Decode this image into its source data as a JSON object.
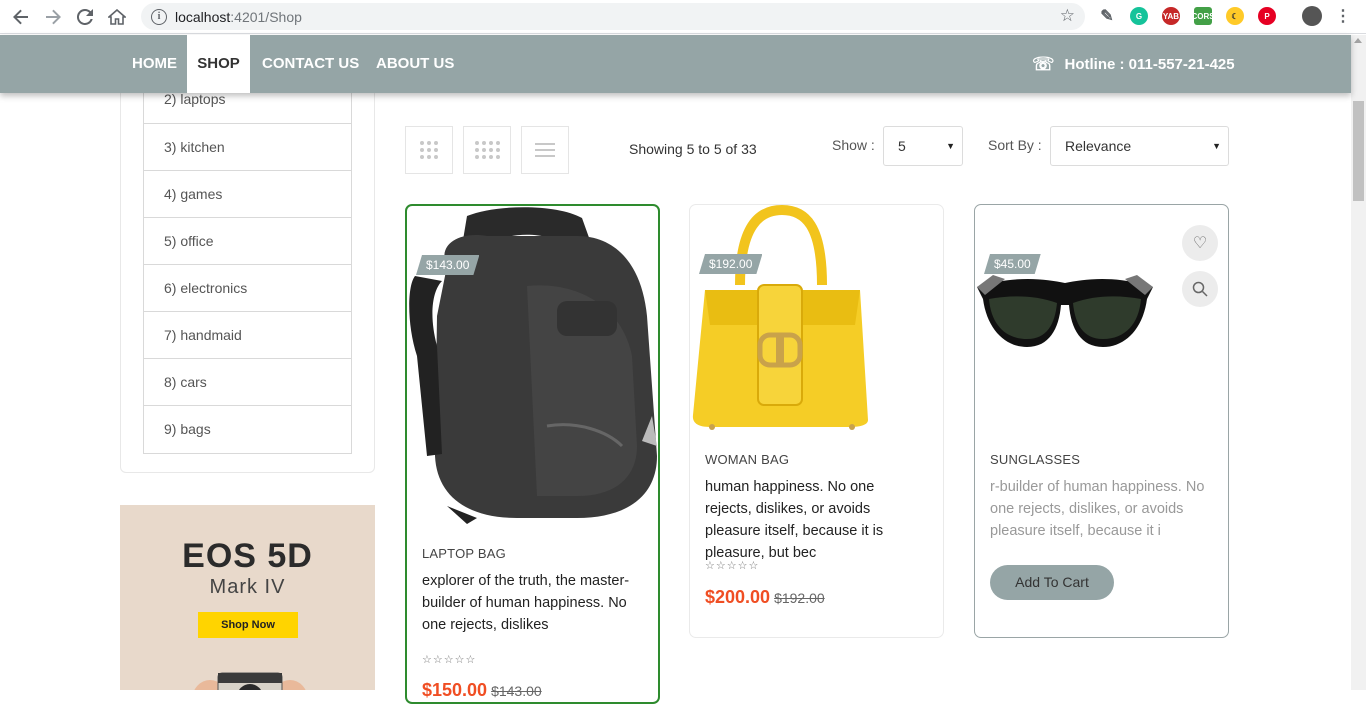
{
  "browser": {
    "url_host": "localhost",
    "url_port_path": ":4201/Shop"
  },
  "nav": {
    "items": [
      {
        "label": "HOME"
      },
      {
        "label": "SHOP"
      },
      {
        "label": "CONTACT US"
      },
      {
        "label": "ABOUT US"
      }
    ],
    "active": "SHOP",
    "hotline": "Hotline : 011-557-21-425"
  },
  "sidebar": {
    "categories": [
      "2) laptops",
      "3) kitchen",
      "4) games",
      "5) office",
      "6) electronics",
      "7) handmaid",
      "8) cars",
      "9) bags"
    ],
    "banner": {
      "title": "EOS 5D",
      "subtitle": "Mark IV",
      "button": "Shop Now"
    }
  },
  "toolbar": {
    "showing": "Showing 5 to 5 of 33",
    "show_label": "Show :",
    "show_value": "5",
    "sort_label": "Sort By :",
    "sort_value": "Relevance"
  },
  "products": [
    {
      "tag": "$143.00",
      "category": "LAPTOP BAG",
      "description": "explorer of the truth, the master-builder of human happiness. No one rejects, dislikes",
      "stars": "☆☆☆☆☆",
      "price": "$150.00",
      "old_price": "$143.00"
    },
    {
      "tag": "$192.00",
      "category": "WOMAN BAG",
      "description": "human happiness. No one rejects, dislikes, or avoids pleasure itself, because it is pleasure, but bec",
      "stars": "☆☆☆☆☆",
      "price": "$200.00",
      "old_price": "$192.00"
    },
    {
      "tag": "$45.00",
      "category": "SUNGLASSES",
      "description": "r-builder of human happiness. No one rejects, dislikes, or avoids pleasure itself, because it i",
      "add_to_cart": "Add To Cart"
    }
  ],
  "colors": {
    "nav_bg": "#95a5a6",
    "price_red": "#f04e23",
    "selected_border": "#2e8b2e"
  }
}
